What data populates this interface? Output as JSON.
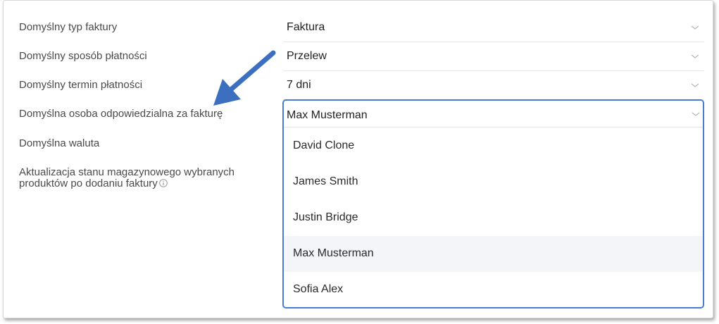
{
  "settings": {
    "rows": [
      {
        "label": "Domyślny typ faktury",
        "value": "Faktura"
      },
      {
        "label": "Domyślny sposób płatności",
        "value": "Przelew"
      },
      {
        "label": "Domyślny termin płatności",
        "value": "7 dni"
      },
      {
        "label": "Domyślna osoba odpowiedzialna za fakturę",
        "value": "Max Musterman"
      },
      {
        "label": "Domyślna waluta"
      },
      {
        "label_line1": "Aktualizacja stanu magazynowego wybranych",
        "label_line2": "produktów po dodaniu faktury"
      }
    ]
  },
  "dropdown": {
    "selected": "Max Musterman",
    "options": [
      "David Clone",
      "James Smith",
      "Justin Bridge",
      "Max Musterman",
      "Sofia Alex"
    ]
  },
  "colors": {
    "accent_border": "#4a7bd3",
    "arrow": "#3c6fc0",
    "hover_bg": "#f3f5f8"
  },
  "icons": {
    "chevron": "chevron-down-icon",
    "info": "info-icon"
  }
}
